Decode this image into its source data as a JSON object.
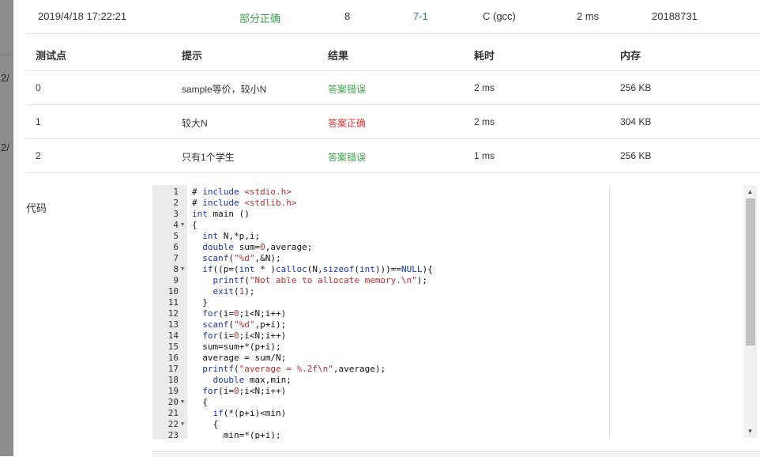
{
  "left_fragments": [
    "2/",
    "2/"
  ],
  "submission": {
    "time": "2019/4/18 17:22:21",
    "status": "部分正确",
    "score": "8",
    "problem": "7-1",
    "compiler": "C (gcc)",
    "duration": "2 ms",
    "user": "20188731",
    "colors": {
      "status": "#3fa34d",
      "problem_link": "#2f6fb5"
    }
  },
  "cases_table": {
    "headers": [
      "测试点",
      "提示",
      "结果",
      "耗时",
      "内存"
    ],
    "rows": [
      {
        "id": "0",
        "hint": "sample等价，较小N",
        "result": "答案错误",
        "result_kind": "wrong",
        "time": "2 ms",
        "memory": "256 KB"
      },
      {
        "id": "1",
        "hint": "较大N",
        "result": "答案正确",
        "result_kind": "right",
        "time": "2 ms",
        "memory": "304 KB"
      },
      {
        "id": "2",
        "hint": "只有1个学生",
        "result": "答案错误",
        "result_kind": "wrong",
        "time": "1 ms",
        "memory": "256 KB"
      }
    ],
    "colors": {
      "wrong": "#3fa34d",
      "right": "#e0332f"
    }
  },
  "code_label": "代码",
  "code": {
    "lines": [
      {
        "n": "1",
        "text": "# include <stdio.h>"
      },
      {
        "n": "2",
        "text": "# include <stdlib.h>"
      },
      {
        "n": "3",
        "text": "int main ()"
      },
      {
        "n": "4",
        "text": "{",
        "fold": true
      },
      {
        "n": "5",
        "text": "  int N,*p,i;"
      },
      {
        "n": "6",
        "text": "  double sum=0,average;"
      },
      {
        "n": "7",
        "text": "  scanf(\"%d\",&N);"
      },
      {
        "n": "8",
        "text": "  if((p=(int * )calloc(N,sizeof(int)))==NULL){",
        "fold": true
      },
      {
        "n": "9",
        "text": "    printf(\"Not able to allocate memory.\\n\");"
      },
      {
        "n": "10",
        "text": "    exit(1);"
      },
      {
        "n": "11",
        "text": "  }"
      },
      {
        "n": "12",
        "text": "  for(i=0;i<N;i++)"
      },
      {
        "n": "13",
        "text": "  scanf(\"%d\",p+i);"
      },
      {
        "n": "14",
        "text": "  for(i=0;i<N;i++)"
      },
      {
        "n": "15",
        "text": "  sum=sum+*(p+i);"
      },
      {
        "n": "16",
        "text": "  average = sum/N;"
      },
      {
        "n": "17",
        "text": "  printf(\"average = %.2f\\n\",average);"
      },
      {
        "n": "18",
        "text": "    double max,min;"
      },
      {
        "n": "19",
        "text": "  for(i=0;i<N;i++)"
      },
      {
        "n": "20",
        "text": "  {",
        "fold": true
      },
      {
        "n": "21",
        "text": "    if(*(p+i)<min)"
      },
      {
        "n": "22",
        "text": "    {",
        "fold": true
      },
      {
        "n": "23",
        "text": "      min=*(p+i);"
      }
    ]
  },
  "icons": {
    "fold": "triangle-down",
    "scroll_up": "triangle-up",
    "scroll_down": "triangle-down"
  }
}
